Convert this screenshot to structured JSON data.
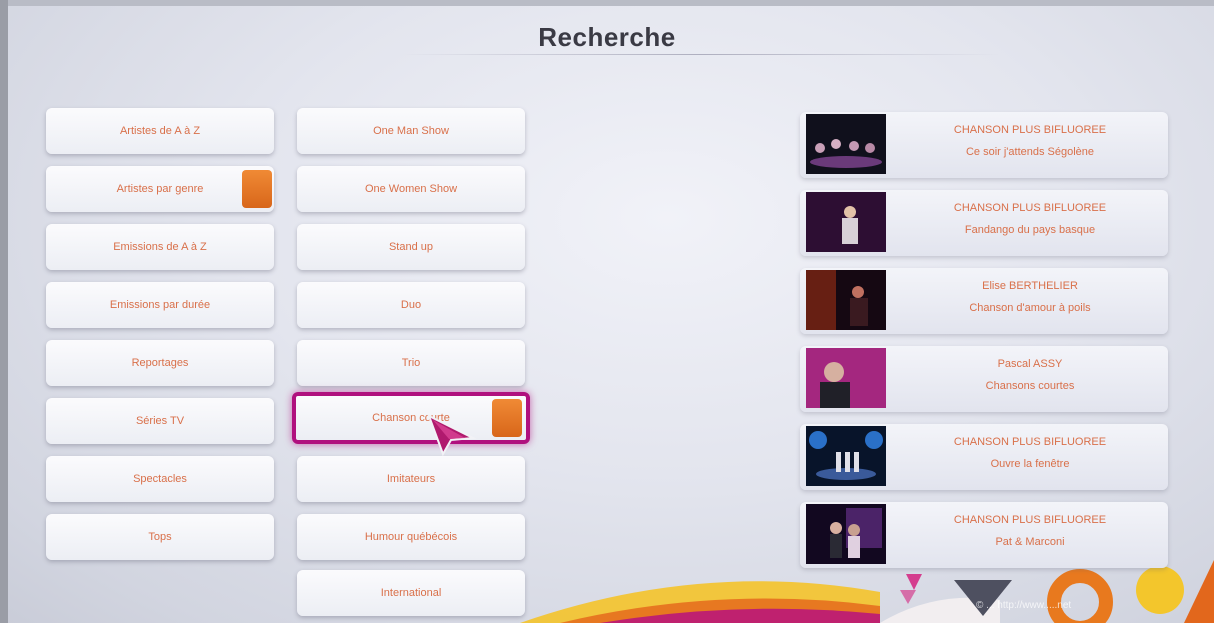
{
  "page": {
    "title": "Recherche"
  },
  "menu_col1": [
    {
      "label": "Artistes de A à Z"
    },
    {
      "label": "Artistes par genre"
    },
    {
      "label": "Emissions de A à Z"
    },
    {
      "label": "Emissions par durée"
    },
    {
      "label": "Reportages"
    },
    {
      "label": "Séries TV"
    },
    {
      "label": "Spectacles"
    },
    {
      "label": "Tops"
    }
  ],
  "menu_col2": [
    {
      "label": "One Man Show"
    },
    {
      "label": "One Women Show"
    },
    {
      "label": "Stand up"
    },
    {
      "label": "Duo"
    },
    {
      "label": "Trio"
    },
    {
      "label": "Chanson courte"
    },
    {
      "label": "Imitateurs"
    },
    {
      "label": "Humour québécois"
    },
    {
      "label": "International"
    }
  ],
  "results": [
    {
      "artist": "CHANSON PLUS BIFLUOREE",
      "title": "Ce soir j'attends Ségolène"
    },
    {
      "artist": "CHANSON PLUS BIFLUOREE",
      "title": "Fandango du pays basque"
    },
    {
      "artist": "Elise BERTHELIER",
      "title": "Chanson d'amour à poils"
    },
    {
      "artist": "Pascal ASSY",
      "title": "Chansons courtes"
    },
    {
      "artist": "CHANSON PLUS BIFLUOREE",
      "title": "Ouvre la fenêtre"
    },
    {
      "artist": "CHANSON PLUS BIFLUOREE",
      "title": "Pat & Marconi"
    }
  ],
  "watermark": "© ... http://www.....net",
  "colors": {
    "label": "#d9704a",
    "focus": "#b0107e",
    "tag": "#e8781f",
    "title": "#3a3a44"
  }
}
